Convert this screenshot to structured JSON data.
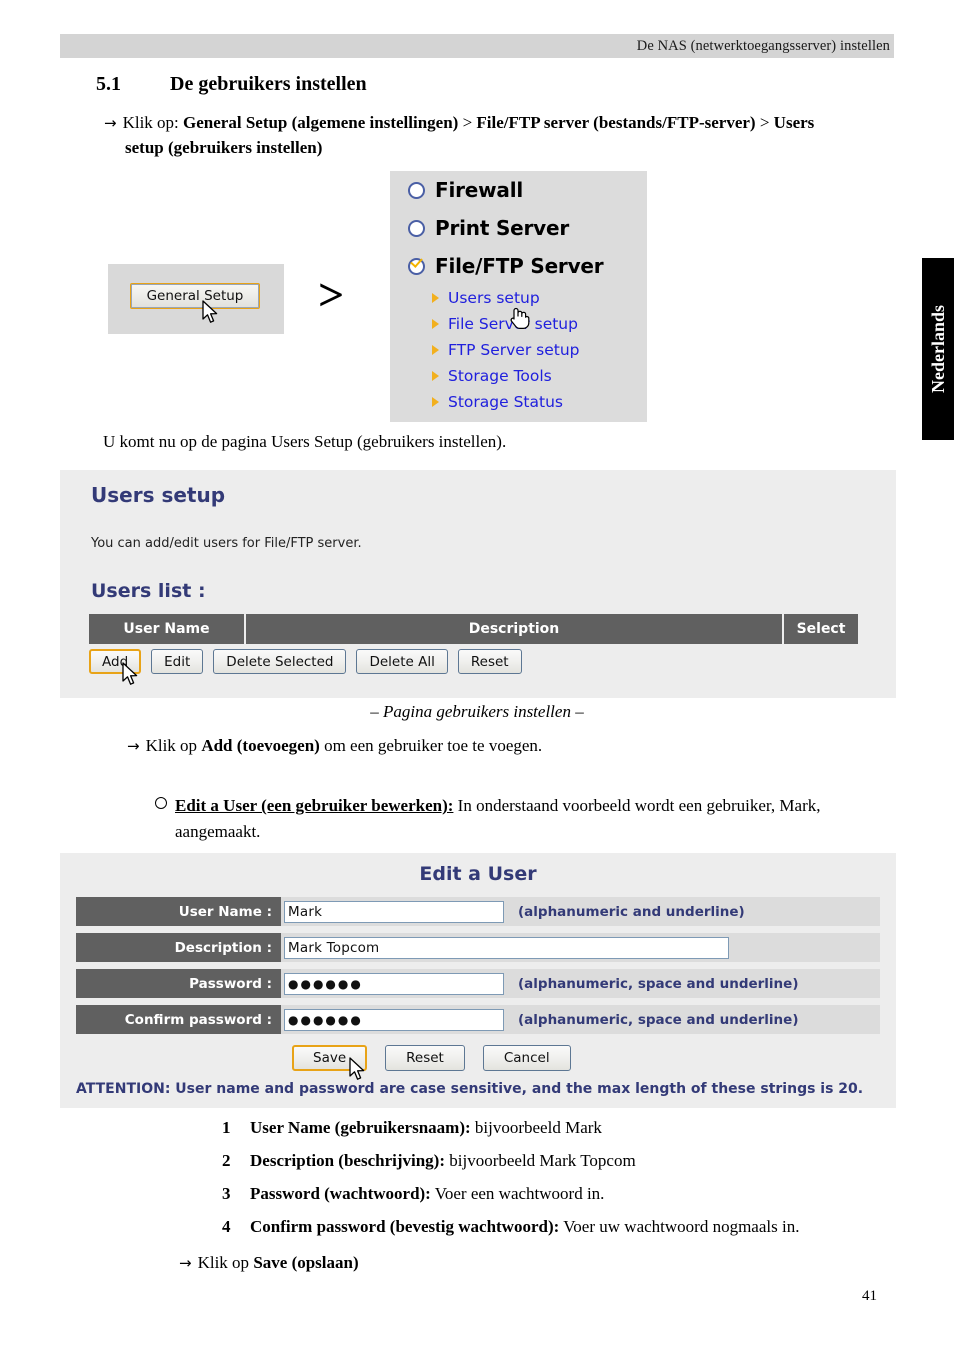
{
  "header": {
    "running_title": "De NAS (netwerktoegangsserver) instellen"
  },
  "section": {
    "number": "5.1",
    "title": "De gebruikers instellen",
    "instruction_prefix": "Klik op: ",
    "instruction_b1": "General Setup (algemene instellingen)",
    "instruction_sep1": " > ",
    "instruction_b2": "File/FTP server (bestands/FTP-server)",
    "instruction_sep2": " > ",
    "instruction_b3": "Users setup (gebruikers instellen)"
  },
  "general_setup_shot": {
    "button_label": "General Setup",
    "separator": ">"
  },
  "menu_shot": {
    "main_items": [
      {
        "label": "Firewall",
        "selected": false
      },
      {
        "label": "Print Server",
        "selected": false
      },
      {
        "label": "File/FTP Server",
        "selected": true
      }
    ],
    "sub_items": [
      {
        "label": "Users setup"
      },
      {
        "label": "File Server setup"
      },
      {
        "label": "FTP Server setup"
      },
      {
        "label": "Storage Tools"
      },
      {
        "label": "Storage Status"
      }
    ]
  },
  "paragraph_komt": "U komt nu op de pagina Users Setup (gebruikers instellen).",
  "users_setup_panel": {
    "title": "Users setup",
    "description": "You can add/edit users for File/FTP server.",
    "list_title": "Users list  :",
    "table_headers": [
      "User Name",
      "Description",
      "Select"
    ],
    "buttons": [
      {
        "label": "Add",
        "focused": true
      },
      {
        "label": "Edit",
        "focused": false
      },
      {
        "label": "Delete Selected",
        "focused": false
      },
      {
        "label": "Delete All",
        "focused": false
      },
      {
        "label": "Reset",
        "focused": false
      }
    ]
  },
  "caption_users": "– Pagina gebruikers instellen –",
  "instruction_add": {
    "prefix": "Klik op ",
    "bold": "Add (toevoegen)",
    "suffix": " om een gebruiker toe te voegen."
  },
  "bullet_edit_user": {
    "bold_underline": "Edit a User (een gebruiker bewerken):",
    "rest": " In onderstaand voorbeeld wordt een gebruiker, Mark, aangemaakt."
  },
  "edit_user_panel": {
    "title": "Edit a User",
    "rows": [
      {
        "label": "User Name  :",
        "value": "Mark",
        "hint": "(alphanumeric and underline)",
        "masked": false,
        "wide": false
      },
      {
        "label": "Description  :",
        "value": "Mark Topcom",
        "hint": "",
        "masked": false,
        "wide": true
      },
      {
        "label": "Password  :",
        "value": "●●●●●●",
        "hint": "(alphanumeric, space and underline)",
        "masked": true,
        "wide": false
      },
      {
        "label": "Confirm password  :",
        "value": "●●●●●●",
        "hint": "(alphanumeric, space and underline)",
        "masked": true,
        "wide": false
      }
    ],
    "buttons": [
      {
        "label": "Save",
        "focused": true
      },
      {
        "label": "Reset",
        "focused": false
      },
      {
        "label": "Cancel",
        "focused": false
      }
    ],
    "attention": "ATTENTION: User name and password are case sensitive, and the max length of these strings is 20."
  },
  "numbered_list": [
    {
      "index": "1",
      "bold": "User Name (gebruikersnaam):",
      "rest": " bijvoorbeeld Mark"
    },
    {
      "index": "2",
      "bold": "Description (beschrijving):",
      "rest": " bijvoorbeeld Mark Topcom"
    },
    {
      "index": "3",
      "bold": "Password (wachtwoord):",
      "rest": " Voer een wachtwoord in."
    },
    {
      "index": "4",
      "bold": "Confirm password (bevestig wachtwoord):",
      "rest": " Voer uw wachtwoord nogmaals in."
    }
  ],
  "instruction_save": {
    "prefix": "Klik op ",
    "bold": "Save (opslaan)"
  },
  "side_tab": {
    "label": "Nederlands"
  },
  "page_number": "41",
  "colors": {
    "panel_bg": "#ededed",
    "heading_navy": "#333a77",
    "label_gray": "#606060",
    "link_blue": "#2020dd",
    "focus_orange": "#e8a317",
    "marker_yellow": "#f2b01e",
    "header_bar": "#d4d4d4"
  }
}
